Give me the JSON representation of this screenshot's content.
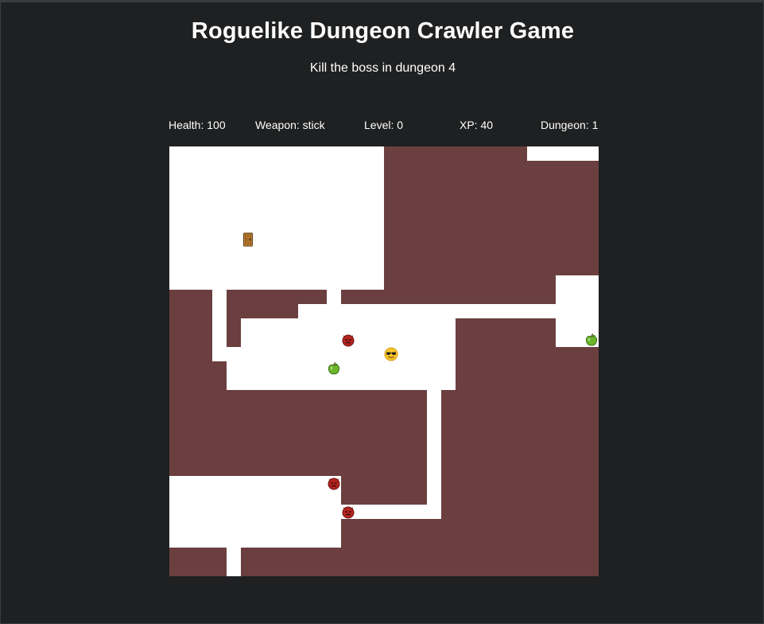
{
  "header": {
    "title": "Roguelike Dungeon Crawler Game",
    "subtitle": "Kill the boss in dungeon 4"
  },
  "stats": {
    "health": "Health: 100",
    "weapon": "Weapon: stick",
    "level": "Level: 0",
    "xp": "XP: 40",
    "dungeon": "Dungeon: 1"
  },
  "colors": {
    "background": "#1f2021",
    "wall": "#6b3f3f",
    "floor": "#ffffff",
    "text": "#ffffff"
  },
  "icons": {
    "player": "sunglasses-face-icon",
    "enemy": "devil-face-icon",
    "health": "green-apple-icon",
    "exit": "door-icon"
  }
}
